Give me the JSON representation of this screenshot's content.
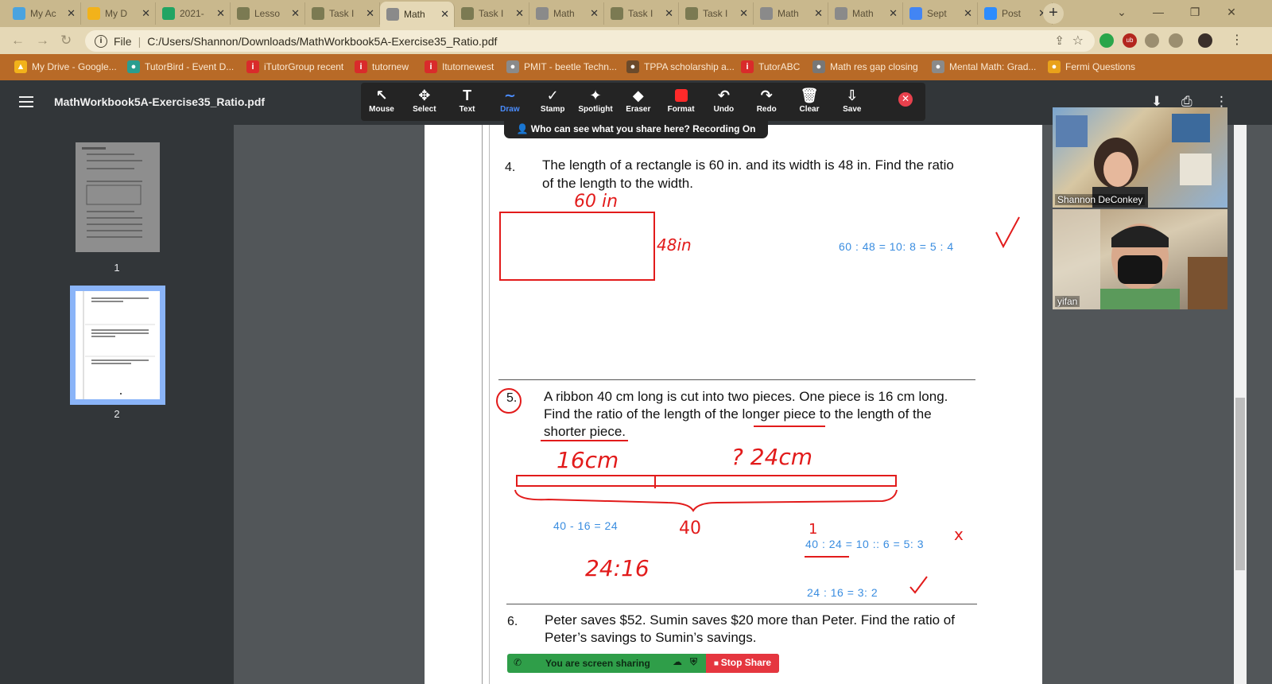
{
  "tabs": [
    {
      "label": "My Ac",
      "color": "#4aa3df"
    },
    {
      "label": "My D",
      "color": "#f2b21a"
    },
    {
      "label": "2021-",
      "color": "#21a463"
    },
    {
      "label": "Lesso",
      "color": "#7b7a52"
    },
    {
      "label": "Task I",
      "color": "#7b7a52"
    },
    {
      "label": "Math",
      "color": "#8a8a8a"
    },
    {
      "label": "Task I",
      "color": "#7b7a52"
    },
    {
      "label": "Math",
      "color": "#8a8a8a"
    },
    {
      "label": "Task I",
      "color": "#7b7a52"
    },
    {
      "label": "Task I",
      "color": "#7b7a52"
    },
    {
      "label": "Math",
      "color": "#8a8a8a"
    },
    {
      "label": "Math",
      "color": "#8a8a8a"
    },
    {
      "label": "Sept",
      "color": "#4285f4"
    },
    {
      "label": "Post",
      "color": "#2d8cff"
    }
  ],
  "active_tab_index": 5,
  "address": {
    "scheme": "File",
    "url": "C:/Users/Shannon/Downloads/MathWorkbook5A-Exercise35_Ratio.pdf"
  },
  "bookmarks": [
    {
      "label": "My Drive - Google...",
      "color": "#f2b21a",
      "glyph": "▲"
    },
    {
      "label": "TutorBird - Event D...",
      "color": "#2a9d8f",
      "glyph": "●"
    },
    {
      "label": "iTutorGroup recent",
      "color": "#d92b2b",
      "glyph": "i"
    },
    {
      "label": "tutornew",
      "color": "#d92b2b",
      "glyph": "i"
    },
    {
      "label": "Itutornewest",
      "color": "#d92b2b",
      "glyph": "i"
    },
    {
      "label": "PMIT - beetle Techn...",
      "color": "#8a8a8a",
      "glyph": "●"
    },
    {
      "label": "TPPA scholarship a...",
      "color": "#6b4a2b",
      "glyph": "●"
    },
    {
      "label": "TutorABC",
      "color": "#d92b2b",
      "glyph": "i"
    },
    {
      "label": "Math res gap closing",
      "color": "#777777",
      "glyph": "●"
    },
    {
      "label": "Mental Math: Grad...",
      "color": "#8a8a8a",
      "glyph": "●"
    },
    {
      "label": "Fermi Questions",
      "color": "#e9a21a",
      "glyph": "●"
    }
  ],
  "pdf": {
    "title": "MathWorkbook5A-Exercise35_Ratio.pdf",
    "thumb_pages": [
      "1",
      "2"
    ]
  },
  "annotate_toolbar": {
    "buttons": [
      {
        "label": "Mouse",
        "icon": "↖",
        "name": "mouse"
      },
      {
        "label": "Select",
        "icon": "✥",
        "name": "select"
      },
      {
        "label": "Text",
        "icon": "T",
        "name": "text"
      },
      {
        "label": "Draw",
        "icon": "∼",
        "name": "draw"
      },
      {
        "label": "Stamp",
        "icon": "✓",
        "name": "stamp"
      },
      {
        "label": "Spotlight",
        "icon": "✦",
        "name": "spotlight"
      },
      {
        "label": "Eraser",
        "icon": "◆",
        "name": "eraser"
      },
      {
        "label": "Format",
        "icon": "■",
        "name": "format"
      },
      {
        "label": "Undo",
        "icon": "↶",
        "name": "undo"
      },
      {
        "label": "Redo",
        "icon": "↷",
        "name": "redo"
      },
      {
        "label": "Clear",
        "icon": "🗑",
        "name": "clear"
      },
      {
        "label": "Save",
        "icon": "⇩",
        "name": "save"
      }
    ],
    "active": "Draw",
    "format_color": "#ff2a2a"
  },
  "share_notice": "Who can see what you share here? Recording On",
  "questions": {
    "q4": {
      "num": "4.",
      "line1": "The length of a rectangle is 60 in. and its width is 48 in. Find the ratio",
      "line2": "of the length to the width.",
      "answer": "60 : 48 = 10: 8 = 5 : 4"
    },
    "q5": {
      "num": "5.",
      "line1": "A ribbon 40 cm long is cut into two pieces. One piece is 16 cm long.",
      "line2": "Find the ratio of the length of the longer piece to the length of the",
      "line3": "shorter piece.",
      "calc": "40 - 16 = 24",
      "wrong": "40 : 24 = 10 :: 6 = 5: 3",
      "right": "24 : 16 = 3: 2"
    },
    "q6": {
      "num": "6.",
      "line1": "Peter saves $52. Sumin saves $20 more than Peter. Find the ratio of",
      "line2": "Peter’s savings to Sumin’s savings."
    }
  },
  "handwriting": {
    "len60": "60 in",
    "wid48": "48in",
    "p16": "16cm",
    "p24": "? 24cm",
    "total40": "40",
    "ratio": "24:16",
    "one": "1",
    "cross": "x"
  },
  "participants": [
    {
      "name": "Shannon DeConkey"
    },
    {
      "name": "yifan"
    }
  ],
  "sharebar": {
    "text": "You are screen sharing",
    "stop": "Stop Share"
  }
}
